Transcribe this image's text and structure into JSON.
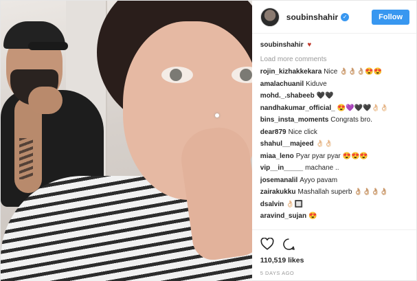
{
  "post": {
    "username": "soubinshahir",
    "follow_label": "Follow",
    "caption_user": "soubinshahir",
    "caption_text": "♥",
    "load_more": "Load more comments",
    "comments": [
      {
        "user": "rojin_kizhakkekara",
        "text": "Nice 👌🏼👌🏼👌🏼😍😍"
      },
      {
        "user": "amalachuanil",
        "text": "Kiduve"
      },
      {
        "user": "mohd._.shabeeb",
        "text": "🖤🖤"
      },
      {
        "user": "nandhakumar_official_",
        "text": "😍💜🖤🖤👌🏻👌🏻"
      },
      {
        "user": "bins_insta_moments",
        "text": "Congrats bro."
      },
      {
        "user": "dear879",
        "text": "Nice click"
      },
      {
        "user": "shahul__majeed",
        "text": "👌🏻👌🏻"
      },
      {
        "user": "miaa_leno",
        "text": "Pyar pyar pyar 😍😍😍"
      },
      {
        "user": "vip__in_____",
        "text": "machane .."
      },
      {
        "user": "josemanalil",
        "text": "Ayyo pavam"
      },
      {
        "user": "zairakukku",
        "text": "Mashallah superb 👌🏼👌🏼👌🏼👌🏼"
      },
      {
        "user": "dsalvin",
        "text": "👌🏻🔲"
      },
      {
        "user": "aravind_sujan",
        "text": "😍"
      }
    ],
    "likes": "110,519 likes",
    "time": "5 DAYS AGO"
  },
  "icons": {
    "like": "heart-outline-icon",
    "comment": "comment-bubble-icon",
    "verified": "verified-badge-icon"
  },
  "colors": {
    "accent": "#3897f0",
    "muted": "#999999"
  }
}
